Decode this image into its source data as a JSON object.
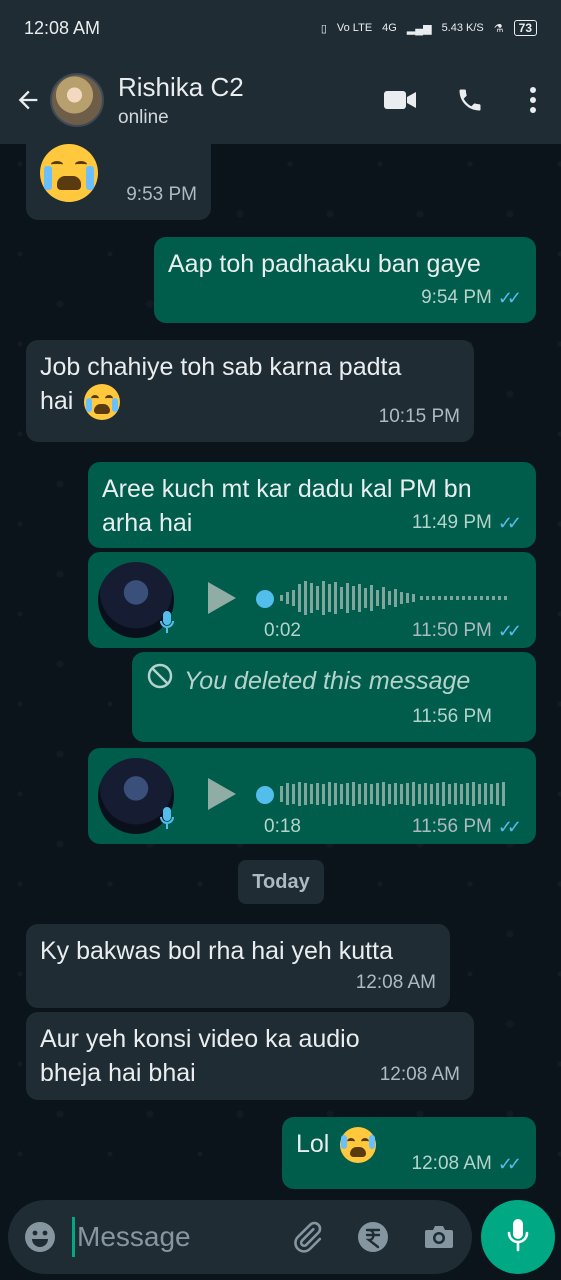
{
  "status_bar": {
    "time": "12:08 AM",
    "network": "Vo LTE",
    "signal": "4G",
    "speed": "5.43 K/S",
    "battery": "73"
  },
  "header": {
    "name": "Rishika C2",
    "status": "online"
  },
  "messages": [
    {
      "text": "",
      "time": "9:53 PM",
      "direction": "incoming"
    },
    {
      "text": "Aap toh padhaaku ban gaye",
      "time": "9:54 PM",
      "direction": "outgoing"
    },
    {
      "text": "Job chahiye toh sab karna padta hai",
      "line1": "Job chahiye toh sab karna padta",
      "line2": "hai",
      "time": "10:15 PM",
      "direction": "incoming"
    },
    {
      "text": "Aree kuch mt kar dadu kal PM bn arha hai",
      "line1": "Aree kuch mt kar dadu kal PM bn",
      "line2": "arha hai",
      "time": "11:49 PM",
      "direction": "outgoing"
    },
    {
      "type": "voice",
      "duration": "0:02",
      "time": "11:50 PM",
      "direction": "outgoing"
    },
    {
      "type": "deleted",
      "text": "You deleted this message",
      "time": "11:56 PM",
      "direction": "outgoing"
    },
    {
      "type": "voice",
      "duration": "0:18",
      "time": "11:56 PM",
      "direction": "outgoing"
    },
    {
      "text": "Ky bakwas bol rha hai yeh kutta",
      "time": "12:08 AM",
      "direction": "incoming"
    },
    {
      "text": "Aur yeh konsi video ka audio bheja hai bhai",
      "line1": "Aur yeh konsi video ka audio",
      "line2": "bheja hai bhai",
      "time": "12:08 AM",
      "direction": "incoming"
    },
    {
      "text": "Lol",
      "time": "12:08 AM",
      "direction": "outgoing"
    }
  ],
  "day_divider": "Today",
  "composer": {
    "placeholder": "Message"
  },
  "colors": {
    "background": "#0b141a",
    "bar": "#1f2c34",
    "incoming": "#202c33",
    "outgoing": "#005c4b",
    "accent": "#00a884",
    "read_ticks": "#53bdeb"
  },
  "icons": [
    "back-arrow-icon",
    "video-call-icon",
    "phone-icon",
    "more-icon",
    "emoji-icon",
    "attach-icon",
    "rupee-icon",
    "camera-icon",
    "mic-icon",
    "play-icon",
    "blocked-icon",
    "double-check-icon"
  ]
}
